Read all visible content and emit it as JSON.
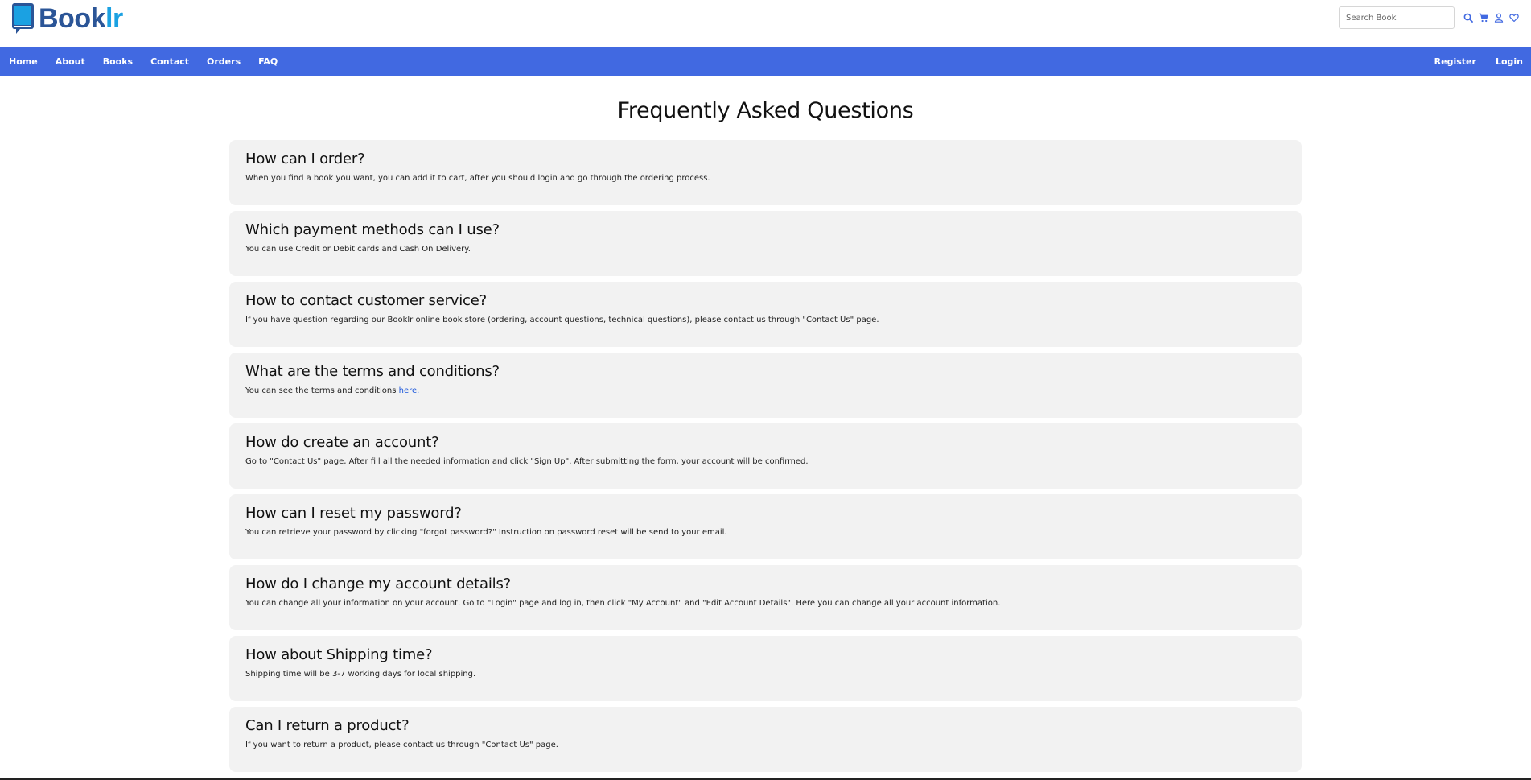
{
  "brand": {
    "name_part1": "Book",
    "name_part2": "lr",
    "colors": {
      "primary": "#2b5597",
      "accent": "#1ba1e2"
    }
  },
  "header": {
    "search_placeholder": "Search Book",
    "icons": [
      "search-icon",
      "cart-icon",
      "user-icon",
      "heart-icon"
    ]
  },
  "nav": {
    "background": "#4169e1",
    "left": [
      "Home",
      "About",
      "Books",
      "Contact",
      "Orders",
      "FAQ"
    ],
    "right": [
      "Register",
      "Login"
    ]
  },
  "page": {
    "title": "Frequently Asked Questions"
  },
  "faq": [
    {
      "question": "How can I order?",
      "answer": "When you find a book you want, you can add it to cart, after you should login and go through the ordering process."
    },
    {
      "question": "Which payment methods can I use?",
      "answer": "You can use Credit or Debit cards and Cash On Delivery."
    },
    {
      "question": "How to contact customer service?",
      "answer": "If you have question regarding our Booklr online book store (ordering, account questions, technical questions), please contact us through \"Contact Us\" page."
    },
    {
      "question": "What are the terms and conditions?",
      "answer": "You can see the terms and conditions ",
      "link_text": "here."
    },
    {
      "question": "How do create an account?",
      "answer": "Go to \"Contact Us\" page, After fill all the needed information and click \"Sign Up\". After submitting the form, your account will be confirmed."
    },
    {
      "question": "How can I reset my password?",
      "answer": "You can retrieve your password by clicking \"forgot password?\" Instruction on password reset will be send to your email."
    },
    {
      "question": "How do I change my account details?",
      "answer": "You can change all your information on your account. Go to \"Login\" page and log in, then click \"My Account\" and \"Edit Account Details\". Here you can change all your account information."
    },
    {
      "question": "How about Shipping time?",
      "answer": "Shipping time will be 3-7 working days for local shipping."
    },
    {
      "question": "Can I return a product?",
      "answer": "If you want to return a product, please contact us through \"Contact Us\" page."
    }
  ]
}
